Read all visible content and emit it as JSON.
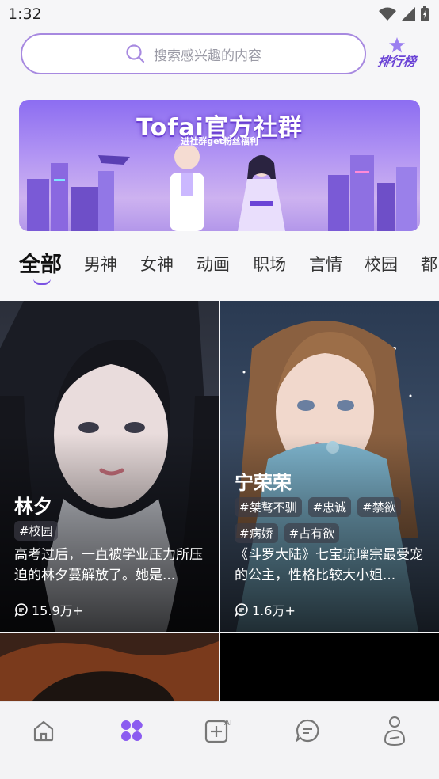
{
  "status_bar": {
    "time": "1:32"
  },
  "search": {
    "placeholder": "搜索感兴趣的内容"
  },
  "ranking": {
    "label": "排行榜"
  },
  "banner": {
    "title": "Tofai官方社群",
    "subtitle": "进社群get粉丝福利"
  },
  "tabs": [
    {
      "label": "全部",
      "active": true
    },
    {
      "label": "男神"
    },
    {
      "label": "女神"
    },
    {
      "label": "动画"
    },
    {
      "label": "职场"
    },
    {
      "label": "言情"
    },
    {
      "label": "校园"
    },
    {
      "label": "都"
    }
  ],
  "cards": [
    {
      "name": "林夕",
      "tags": [
        "#校园"
      ],
      "description": "高考过后，一直被学业压力所压迫的林夕蔓解放了。她是...",
      "chats": "15.9万+"
    },
    {
      "name": "宁荣荣",
      "tags": [
        "#桀骜不驯",
        "#忠诚",
        "#禁欲",
        "#病娇",
        "#占有欲"
      ],
      "description": "《斗罗大陆》七宝琉璃宗最受宠的公主，性格比较大小姐...",
      "chats": "1.6万+"
    }
  ],
  "bottom_nav": {
    "items": [
      "home-icon",
      "discover-icon",
      "create-ai-icon",
      "messages-icon",
      "profile-icon"
    ],
    "active_index": 1
  },
  "colors": {
    "accent": "#7b52e3",
    "accent_light": "#a789e0",
    "nav_bg": "#f3f3f5"
  }
}
